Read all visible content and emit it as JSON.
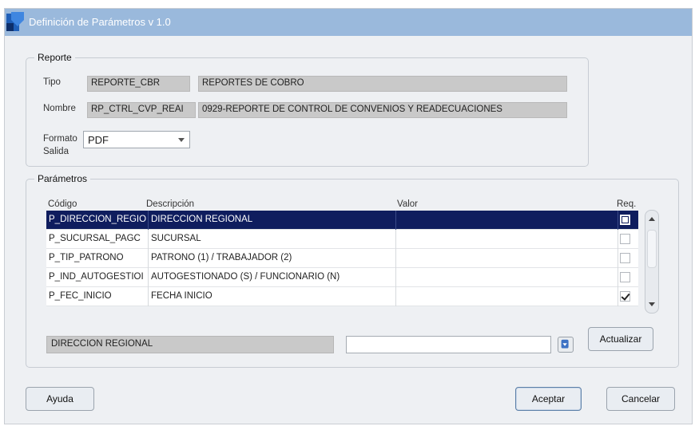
{
  "window": {
    "title": "Definición de Parámetros v 1.0"
  },
  "reporte": {
    "legend": "Reporte",
    "tipo_label": "Tipo",
    "tipo_code": "REPORTE_CBR",
    "tipo_desc": "REPORTES DE COBRO",
    "nombre_label": "Nombre",
    "nombre_code": "RP_CTRL_CVP_REAI",
    "nombre_desc": "0929-REPORTE DE CONTROL DE CONVENIOS Y READECUACIONES",
    "formato_label_1": "Formato",
    "formato_label_2": "Salida",
    "formato_value": "PDF"
  },
  "parametros": {
    "legend": "Parámetros",
    "headers": {
      "codigo": "Código",
      "descripcion": "Descripción",
      "valor": "Valor",
      "req": "Req."
    },
    "rows": [
      {
        "codigo": "P_DIRECCION_REGIO",
        "descripcion": "DIRECCION REGIONAL",
        "valor": "",
        "req": false,
        "selected": true
      },
      {
        "codigo": "P_SUCURSAL_PAGC",
        "descripcion": "SUCURSAL",
        "valor": "",
        "req": false,
        "selected": false
      },
      {
        "codigo": "P_TIP_PATRONO",
        "descripcion": "PATRONO (1) / TRABAJADOR (2)",
        "valor": "",
        "req": false,
        "selected": false
      },
      {
        "codigo": "P_IND_AUTOGESTIOI",
        "descripcion": "AUTOGESTIONADO (S) / FUNCIONARIO (N)",
        "valor": "",
        "req": false,
        "selected": false
      },
      {
        "codigo": "P_FEC_INICIO",
        "descripcion": "FECHA INICIO",
        "valor": "",
        "req": true,
        "selected": false
      }
    ],
    "detail_desc": "DIRECCION REGIONAL",
    "detail_value": "",
    "actualizar_label": "Actualizar"
  },
  "footer": {
    "ayuda_label": "Ayuda",
    "aceptar_label": "Aceptar",
    "cancelar_label": "Cancelar"
  },
  "icons": {
    "app": "app-logo-icon",
    "lov": "list-of-values-icon",
    "scroll_up": "scroll-up-icon",
    "scroll_down": "scroll-down-icon",
    "dropdown": "chevron-down-icon"
  },
  "colors": {
    "titlebar": "#9ab9dc",
    "selected_row": "#0f1d5e",
    "readonly_field": "#c9c9c9"
  }
}
